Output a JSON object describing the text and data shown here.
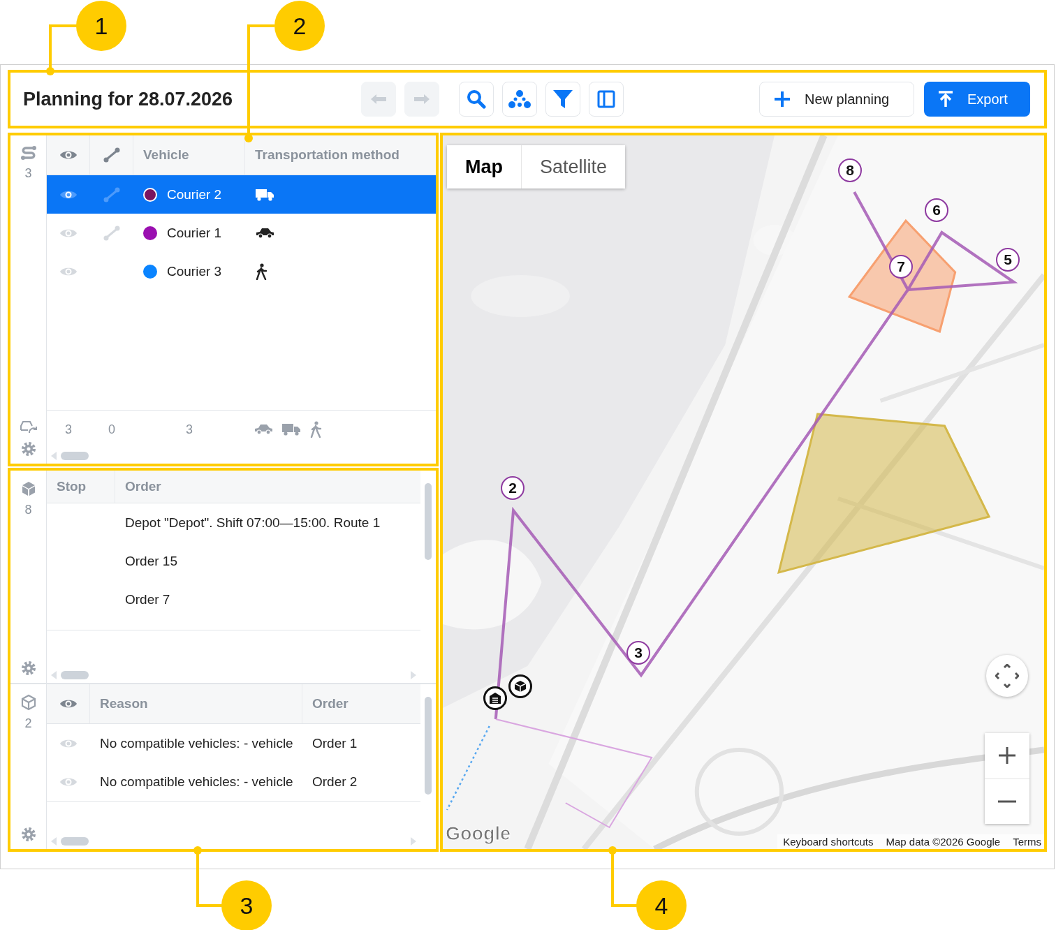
{
  "callouts": [
    "1",
    "2",
    "3",
    "4"
  ],
  "header": {
    "title": "Planning for 28.07.2026",
    "nav_buttons": [
      {
        "kind": "back",
        "disabled": true
      },
      {
        "kind": "forward",
        "disabled": true
      }
    ],
    "tool_buttons": [
      {
        "kind": "search"
      },
      {
        "kind": "cluster"
      },
      {
        "kind": "filter"
      },
      {
        "kind": "panel"
      }
    ],
    "new_planning": "New planning",
    "export": "Export"
  },
  "vehicles": {
    "count": "3",
    "columns": [
      "Vehicle",
      "Transportation method"
    ],
    "rows": [
      {
        "name": "Courier 2",
        "color": "#7a1460",
        "kind": "truck",
        "route_shown": true,
        "selected": true
      },
      {
        "name": "Courier 1",
        "color": "#9a0fb0",
        "kind": "car",
        "route_shown": true,
        "selected": false
      },
      {
        "name": "Courier 3",
        "color": "#0a84ff",
        "kind": "walker",
        "route_shown": false,
        "selected": false
      }
    ],
    "totals": [
      "3",
      "0",
      "3"
    ],
    "footer_icons": [
      {
        "kind": "car"
      },
      {
        "kind": "truck"
      },
      {
        "kind": "walker"
      }
    ]
  },
  "stops": {
    "count": "8",
    "columns": [
      "Stop",
      "Order"
    ],
    "rows": [
      {
        "order": "Depot \"Depot\". Shift 07:00—15:00. Route 1"
      },
      {
        "order": "Order 15"
      },
      {
        "order": "Order 7"
      }
    ]
  },
  "unassigned": {
    "count": "2",
    "columns": [
      "Reason",
      "Order"
    ],
    "rows": [
      {
        "reason": "No compatible vehicles: - vehicle",
        "order": "Order 1"
      },
      {
        "reason": "No compatible vehicles: - vehicle",
        "order": "Order 2"
      }
    ]
  },
  "map": {
    "tabs": [
      {
        "label": "Map",
        "selected": true
      },
      {
        "label": "Satellite",
        "selected": false
      }
    ],
    "zones": [
      {
        "color": "#f7a070"
      },
      {
        "color": "#d4b84a"
      }
    ],
    "markers": [
      {
        "label": "8"
      },
      {
        "label": "6"
      },
      {
        "label": "5"
      },
      {
        "label": "7"
      },
      {
        "label": "2"
      },
      {
        "label": "3"
      }
    ],
    "logo": "Google",
    "attribution": [
      "Keyboard shortcuts",
      "Map data ©2026 Google",
      "Terms"
    ]
  }
}
